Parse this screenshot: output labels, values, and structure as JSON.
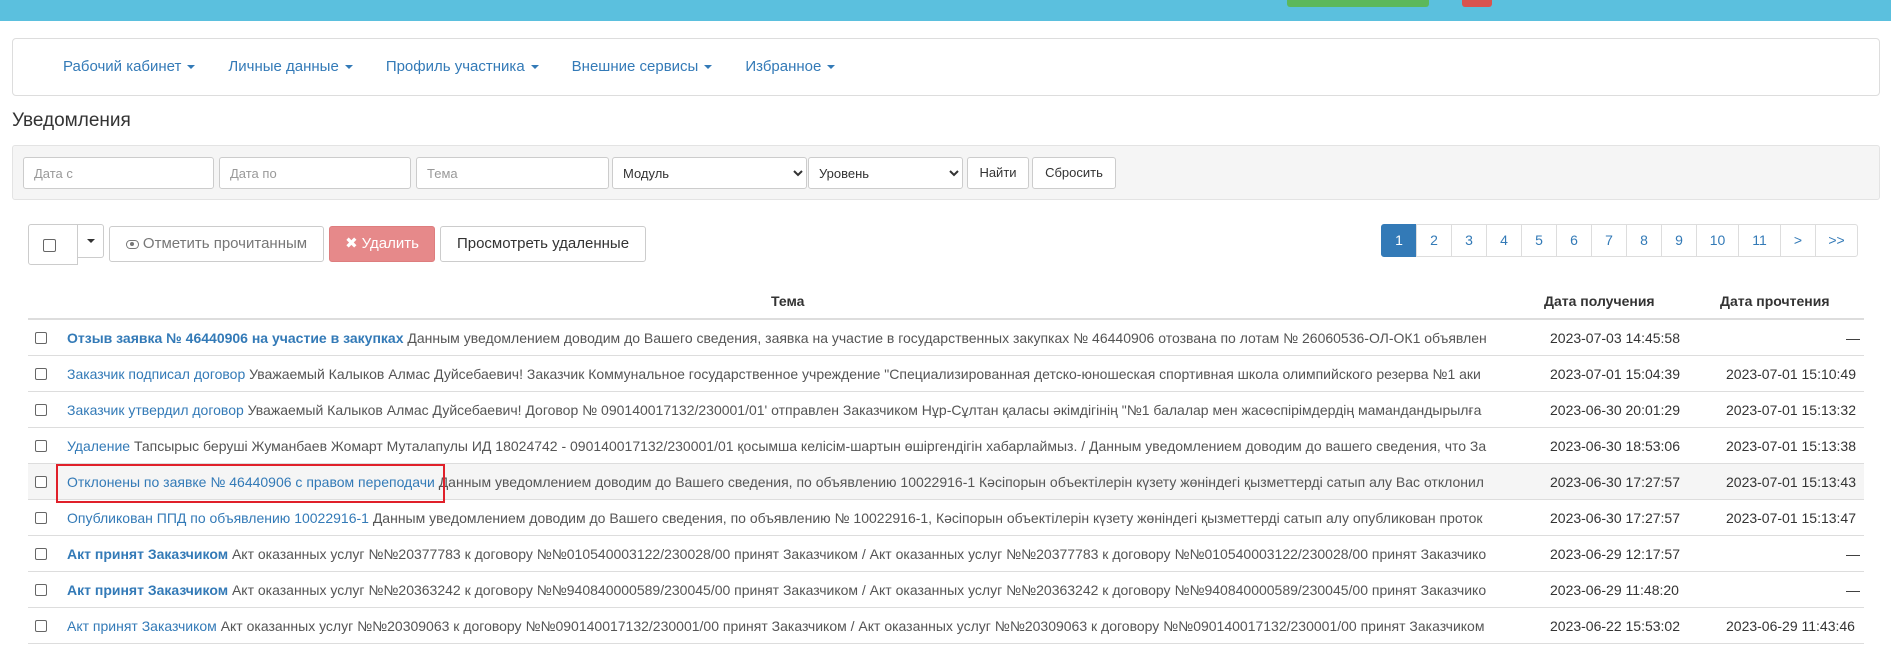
{
  "nav": {
    "items": [
      {
        "label": "Рабочий кабинет"
      },
      {
        "label": "Личные данные"
      },
      {
        "label": "Профиль участника"
      },
      {
        "label": "Внешние сервисы"
      },
      {
        "label": "Избранное"
      }
    ]
  },
  "page_title": "Уведомления",
  "filters": {
    "date_from_placeholder": "Дата с",
    "date_to_placeholder": "Дата по",
    "topic_placeholder": "Тема",
    "module_selected": "Модуль",
    "level_selected": "Уровень",
    "find_label": "Найти",
    "reset_label": "Сбросить"
  },
  "toolbar": {
    "mark_read_label": "Отметить прочитанным",
    "delete_label": "Удалить",
    "view_deleted_label": "Просмотреть удаленные"
  },
  "pagination": {
    "pages": [
      "1",
      "2",
      "3",
      "4",
      "5",
      "6",
      "7",
      "8",
      "9",
      "10",
      "11",
      ">",
      ">>"
    ],
    "active": "1"
  },
  "table": {
    "headers": {
      "subject": "Тема",
      "received": "Дата получения",
      "read": "Дата прочтения"
    },
    "rows": [
      {
        "title": "Отзыв заявка № 46440906 на участие в закупках",
        "bold": true,
        "text": "Данным уведомлением доводим до Вашего сведения, заявка на участие в государственных закупках № 46440906 отозвана по лотам № 26060536-ОЛ-ОК1 объявлен",
        "received": "2023-07-03 14:45:58",
        "read": "—"
      },
      {
        "title": "Заказчик подписал договор",
        "bold": false,
        "text": "Уважаемый Калыков Алмас Дуйсебаевич! Заказчик Коммунальное государственное учреждение \"Специализированная детско-юношеская спортивная школа олимпийского резерва №1 аки",
        "received": "2023-07-01 15:04:39",
        "read": "2023-07-01 15:10:49"
      },
      {
        "title": "Заказчик утвердил договор",
        "bold": false,
        "text": "Уважаемый Калыков Алмас Дуйсебаевич! Договор № 090140017132/230001/01' отправлен Заказчиком Нұр-Сұлтан қаласы әкімдігінің \"№1 балалар мен жасөспірімдердің мамандандырылға",
        "received": "2023-06-30 20:01:29",
        "read": "2023-07-01 15:13:32"
      },
      {
        "title": "Удаление",
        "bold": false,
        "text": "Тапсырыс беруші Жуманбаев Жомарт Муталапулы ИД 18024742 - 090140017132/230001/01 қосымша келісім-шартын өшіргендігін хабарлаймыз. / Данным уведомлением доводим до вашего сведения, что За",
        "received": "2023-06-30 18:53:06",
        "read": "2023-07-01 15:13:38"
      },
      {
        "title": "Отклонены по заявке № 46440906 с правом переподачи",
        "bold": false,
        "text": "Данным уведомлением доводим до Вашего сведения, по объявлению 10022916-1 Кәсіпорын объектілерін күзету жөніндегі қызметтерді сатып алу Вас отклонил",
        "received": "2023-06-30 17:27:57",
        "read": "2023-07-01 15:13:43"
      },
      {
        "title": "Опубликован ППД по объявлению 10022916-1",
        "bold": false,
        "text": "Данным уведомлением доводим до Вашего сведения, по объявлению № 10022916-1, Кәсіпорын объектілерін күзету жөніндегі қызметтерді сатып алу опубликован проток",
        "received": "2023-06-30 17:27:57",
        "read": "2023-07-01 15:13:47"
      },
      {
        "title": "Акт принят Заказчиком",
        "bold": true,
        "text": "Акт оказанных услуг №№20377783 к договору №№010540003122/230028/00 принят Заказчиком / Акт оказанных услуг №№20377783 к договору №№010540003122/230028/00 принят Заказчико",
        "received": "2023-06-29 12:17:57",
        "read": "—"
      },
      {
        "title": "Акт принят Заказчиком",
        "bold": true,
        "text": "Акт оказанных услуг №№20363242 к договору №№940840000589/230045/00 принят Заказчиком / Акт оказанных услуг №№20363242 к договору №№940840000589/230045/00 принят Заказчико",
        "received": "2023-06-29 11:48:20",
        "read": "—"
      },
      {
        "title": "Акт принят Заказчиком",
        "bold": false,
        "text": "Акт оказанных услуг №№20309063 к договору №№090140017132/230001/00 принят Заказчиком / Акт оказанных услуг №№20309063 к договору №№090140017132/230001/00 принят Заказчиком",
        "received": "2023-06-22 15:53:02",
        "read": "2023-06-29 11:43:46"
      }
    ]
  },
  "colors": {
    "topbar": "#5bc0de",
    "link": "#337ab7",
    "danger_button": "#e6898a",
    "highlight_box": "#e0202a"
  }
}
